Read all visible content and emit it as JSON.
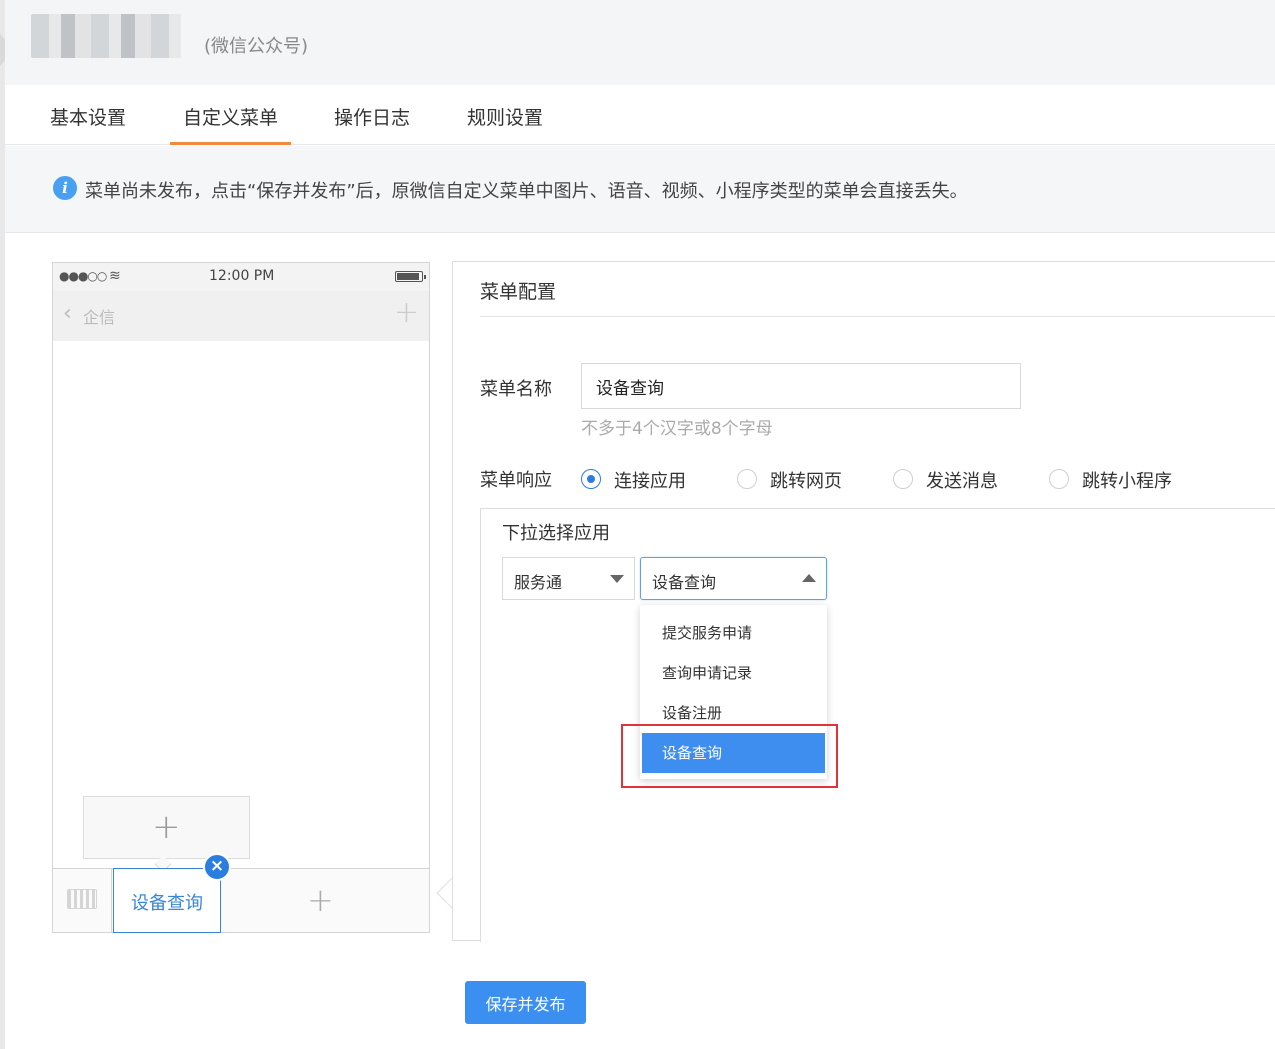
{
  "header": {
    "account_type": "(微信公众号)"
  },
  "tabs": [
    {
      "label": "基本设置",
      "active": false
    },
    {
      "label": "自定义菜单",
      "active": true
    },
    {
      "label": "操作日志",
      "active": false
    },
    {
      "label": "规则设置",
      "active": false
    }
  ],
  "notice": {
    "text": "菜单尚未发布，点击“保存并发布”后，原微信自定义菜单中图片、语音、视频、小程序类型的菜单会直接丢失。"
  },
  "phone": {
    "clock": "12:00 PM",
    "nav_title": "企信",
    "menu_item_label": "设备查询"
  },
  "config": {
    "title": "菜单配置",
    "name_label": "菜单名称",
    "name_value": "设备查询",
    "name_hint": "不多于4个汉字或8个字母",
    "response_label": "菜单响应",
    "response_options": [
      {
        "label": "连接应用",
        "checked": true
      },
      {
        "label": "跳转网页",
        "checked": false
      },
      {
        "label": "发送消息",
        "checked": false
      },
      {
        "label": "跳转小程序",
        "checked": false
      }
    ],
    "app_box_title": "下拉选择应用",
    "select_1_value": "服务通",
    "select_2_value": "设备查询",
    "dropdown_options": [
      {
        "label": "提交服务申请",
        "selected": false
      },
      {
        "label": "查询申请记录",
        "selected": false
      },
      {
        "label": "设备注册",
        "selected": false
      },
      {
        "label": "设备查询",
        "selected": true
      }
    ]
  },
  "footer": {
    "publish_label": "保存并发布"
  },
  "colors": {
    "accent": "#3a8ff0",
    "tab_underline": "#f08a3c",
    "highlight": "#e0343c"
  }
}
